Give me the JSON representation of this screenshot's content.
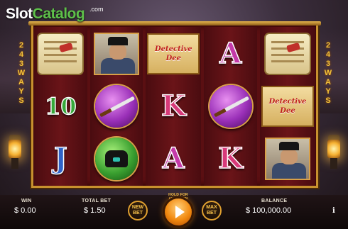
{
  "brand": {
    "name_part1": "Slot",
    "name_part2": "Catalog",
    "suffix": ".com"
  },
  "ways": {
    "left": [
      "2",
      "4",
      "3",
      "W",
      "A",
      "Y",
      "S"
    ],
    "right": [
      "2",
      "4",
      "3",
      "W",
      "A",
      "Y",
      "S"
    ]
  },
  "reels": [
    [
      {
        "type": "scroll",
        "name": "scroll-symbol"
      },
      {
        "type": "letter",
        "class": "sym-10",
        "label": "10"
      },
      {
        "type": "letter",
        "class": "sym-J",
        "label": "J"
      }
    ],
    [
      {
        "type": "portrait",
        "name": "detective-portrait-symbol"
      },
      {
        "type": "orb-purple",
        "name": "sword-orb-symbol"
      },
      {
        "type": "orb-green",
        "name": "hat-orb-symbol"
      }
    ],
    [
      {
        "type": "banner",
        "name": "detective-dee-logo-symbol",
        "line1": "Detective",
        "line2": "Dee"
      },
      {
        "type": "letter",
        "class": "sym-K",
        "label": "K"
      },
      {
        "type": "letter",
        "class": "sym-A",
        "label": "A"
      }
    ],
    [
      {
        "type": "letter",
        "class": "sym-A",
        "label": "A"
      },
      {
        "type": "orb-purple",
        "name": "sword-orb-symbol"
      },
      {
        "type": "letter",
        "class": "sym-K",
        "label": "K"
      }
    ],
    [
      {
        "type": "scroll",
        "name": "scroll-symbol"
      },
      {
        "type": "banner",
        "name": "detective-dee-logo-symbol",
        "line1": "Detective",
        "line2": "Dee"
      },
      {
        "type": "portrait",
        "name": "detective-portrait-symbol"
      }
    ]
  ],
  "hud": {
    "win_label": "WIN",
    "win_value": "$ 0.00",
    "total_bet_label": "TOTAL BET",
    "total_bet_value": "$ 1.50",
    "new_bet_line1": "NEW",
    "new_bet_line2": "BET",
    "hold_for_autospin": "HOLD FOR AUTOSPIN",
    "max_bet_line1": "MAX",
    "max_bet_line2": "BET",
    "balance_label": "BALANCE",
    "balance_value": "$ 100,000.00",
    "info": "i"
  },
  "colors": {
    "frame_gold": "#c8912e",
    "reel_bg": "#5a0f12",
    "spin_orange": "#f28a10"
  }
}
